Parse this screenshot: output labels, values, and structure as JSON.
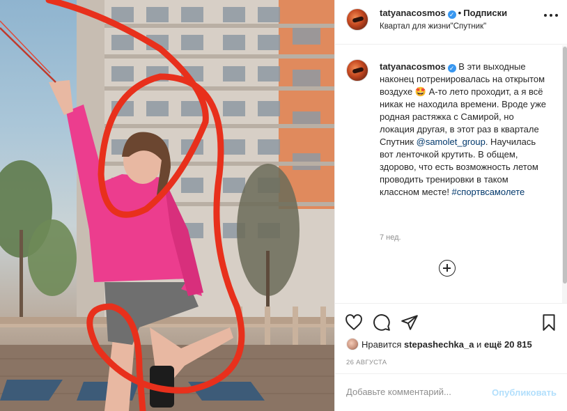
{
  "header": {
    "username": "tatyanacosmos",
    "dot": "•",
    "follow_label": "Подписки",
    "location": "Квартал для жизни\"Спутник\""
  },
  "post": {
    "caption_username": "tatyanacosmos",
    "caption_text_1": "В эти выходные наконец потренировалась на открытом воздухе 🤩 А-то лето проходит, а я всё никак не находила времени. Вроде уже родная растяжка с Самирой, но локация другая, в этот раз в квартале Спутник ",
    "mention": "@samolet_group",
    "caption_text_2": ". Научилась вот ленточкой крутить. В общем, здорово, что есть возможность летом проводить тренировки в таком классном месте! ",
    "hashtag": "#спортвсамолете",
    "time_ago": "7 нед."
  },
  "likes": {
    "prefix": "Нравится ",
    "user": "stepashechka_a",
    "middle": " и ",
    "count": "ещё 20 815"
  },
  "date": "26 АВГУСТА",
  "comment": {
    "placeholder": "Добавьте комментарий...",
    "publish_label": "Опубликовать"
  },
  "icons": [
    "heart-icon",
    "comment-icon",
    "share-icon",
    "save-icon",
    "more-icon",
    "plus-circle-icon",
    "verified-icon"
  ],
  "colors": {
    "link": "#00376b",
    "publish_disabled": "#b2dffc",
    "secondary_text": "#8e8e8e",
    "verified": "#3897f0",
    "ribbon": "#e8301c",
    "hoodie": "#ec3d8e"
  }
}
